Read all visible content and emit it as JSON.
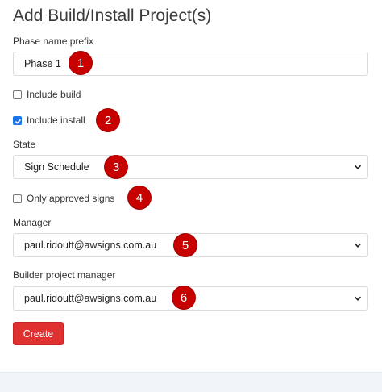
{
  "page": {
    "title": "Add Build/Install Project(s)"
  },
  "form": {
    "phase_prefix": {
      "label": "Phase name prefix",
      "value": "Phase 1"
    },
    "include_build": {
      "label": "Include build",
      "checked": false
    },
    "include_install": {
      "label": "Include install",
      "checked": true
    },
    "state": {
      "label": "State",
      "value": "Sign Schedule"
    },
    "only_approved": {
      "label": "Only approved signs",
      "checked": false
    },
    "manager": {
      "label": "Manager",
      "value": "paul.ridoutt@awsigns.com.au"
    },
    "builder_pm": {
      "label": "Builder project manager",
      "value": "paul.ridoutt@awsigns.com.au"
    },
    "create_label": "Create"
  },
  "badges": [
    "1",
    "2",
    "3",
    "4",
    "5",
    "6"
  ],
  "colors": {
    "accent": "#e03131",
    "badge": "#c70000",
    "checkbox": "#1a73e8"
  }
}
